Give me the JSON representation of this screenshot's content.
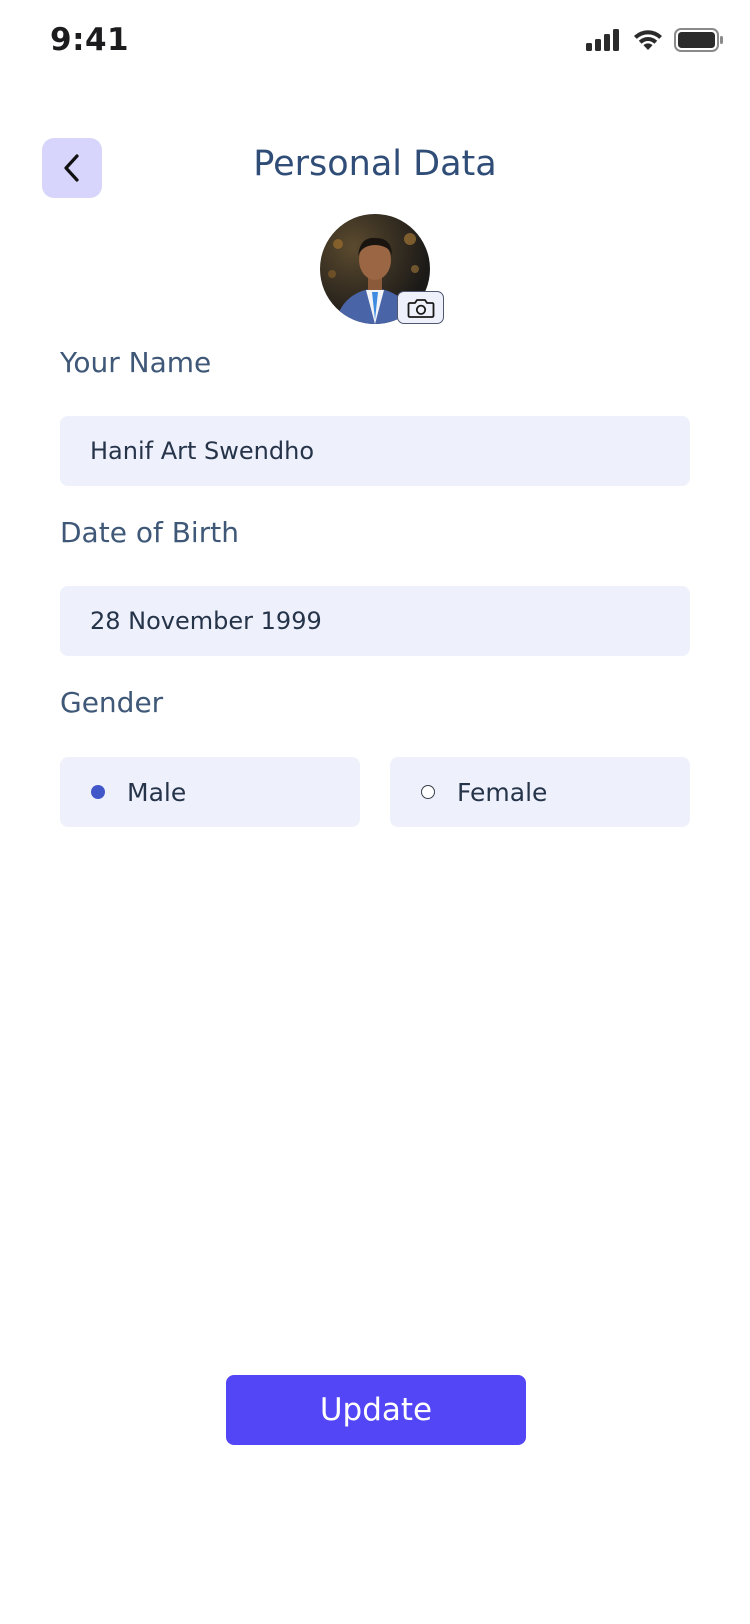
{
  "status_bar": {
    "time": "9:41"
  },
  "header": {
    "title": "Personal Data",
    "back_icon": "chevron-left-icon"
  },
  "avatar": {
    "camera_icon": "camera-icon"
  },
  "form": {
    "name": {
      "label": "Your Name",
      "value": "Hanif Art Swendho"
    },
    "dob": {
      "label": "Date of Birth",
      "value": "28 November 1999"
    },
    "gender": {
      "label": "Gender",
      "options": [
        {
          "label": "Male",
          "selected": true
        },
        {
          "label": "Female",
          "selected": false
        }
      ]
    }
  },
  "actions": {
    "update_label": "Update"
  },
  "colors": {
    "accent": "#5246f6",
    "field_bg": "#eef1fc",
    "back_bg": "#d7d5fb",
    "title": "#2f4d77"
  }
}
